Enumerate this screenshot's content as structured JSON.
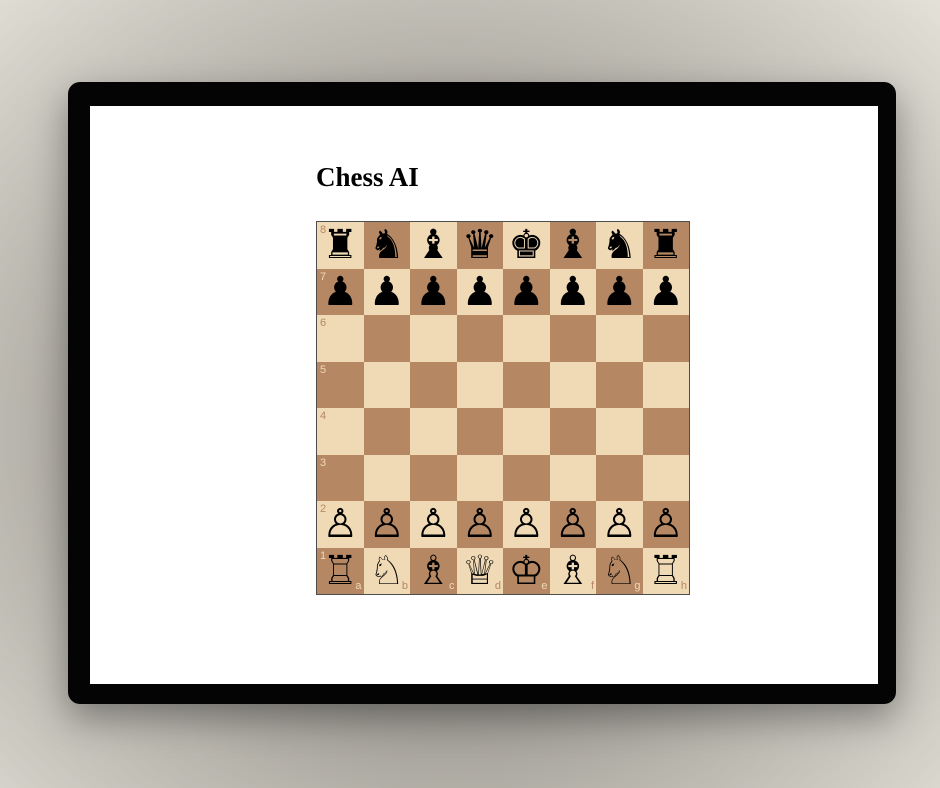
{
  "page": {
    "title": "Chess AI"
  },
  "board": {
    "files": [
      "a",
      "b",
      "c",
      "d",
      "e",
      "f",
      "g",
      "h"
    ],
    "ranks": [
      "8",
      "7",
      "6",
      "5",
      "4",
      "3",
      "2",
      "1"
    ],
    "colors": {
      "light_square": "#f0d9b5",
      "dark_square": "#b58863"
    },
    "position": [
      [
        "bR",
        "bN",
        "bB",
        "bQ",
        "bK",
        "bB",
        "bN",
        "bR"
      ],
      [
        "bP",
        "bP",
        "bP",
        "bP",
        "bP",
        "bP",
        "bP",
        "bP"
      ],
      [
        "",
        "",
        "",
        "",
        "",
        "",
        "",
        ""
      ],
      [
        "",
        "",
        "",
        "",
        "",
        "",
        "",
        ""
      ],
      [
        "",
        "",
        "",
        "",
        "",
        "",
        "",
        ""
      ],
      [
        "",
        "",
        "",
        "",
        "",
        "",
        "",
        ""
      ],
      [
        "wP",
        "wP",
        "wP",
        "wP",
        "wP",
        "wP",
        "wP",
        "wP"
      ],
      [
        "wR",
        "wN",
        "wB",
        "wQ",
        "wK",
        "wB",
        "wN",
        "wR"
      ]
    ]
  },
  "pieces": {
    "wK": {
      "glyph": "♔",
      "name": "white-king-icon"
    },
    "wQ": {
      "glyph": "♕",
      "name": "white-queen-icon"
    },
    "wR": {
      "glyph": "♖",
      "name": "white-rook-icon"
    },
    "wB": {
      "glyph": "♗",
      "name": "white-bishop-icon"
    },
    "wN": {
      "glyph": "♘",
      "name": "white-knight-icon"
    },
    "wP": {
      "glyph": "♙",
      "name": "white-pawn-icon"
    },
    "bK": {
      "glyph": "♚",
      "name": "black-king-icon"
    },
    "bQ": {
      "glyph": "♛",
      "name": "black-queen-icon"
    },
    "bR": {
      "glyph": "♜",
      "name": "black-rook-icon"
    },
    "bB": {
      "glyph": "♝",
      "name": "black-bishop-icon"
    },
    "bN": {
      "glyph": "♞",
      "name": "black-knight-icon"
    },
    "bP": {
      "glyph": "♟",
      "name": "black-pawn-icon"
    }
  }
}
